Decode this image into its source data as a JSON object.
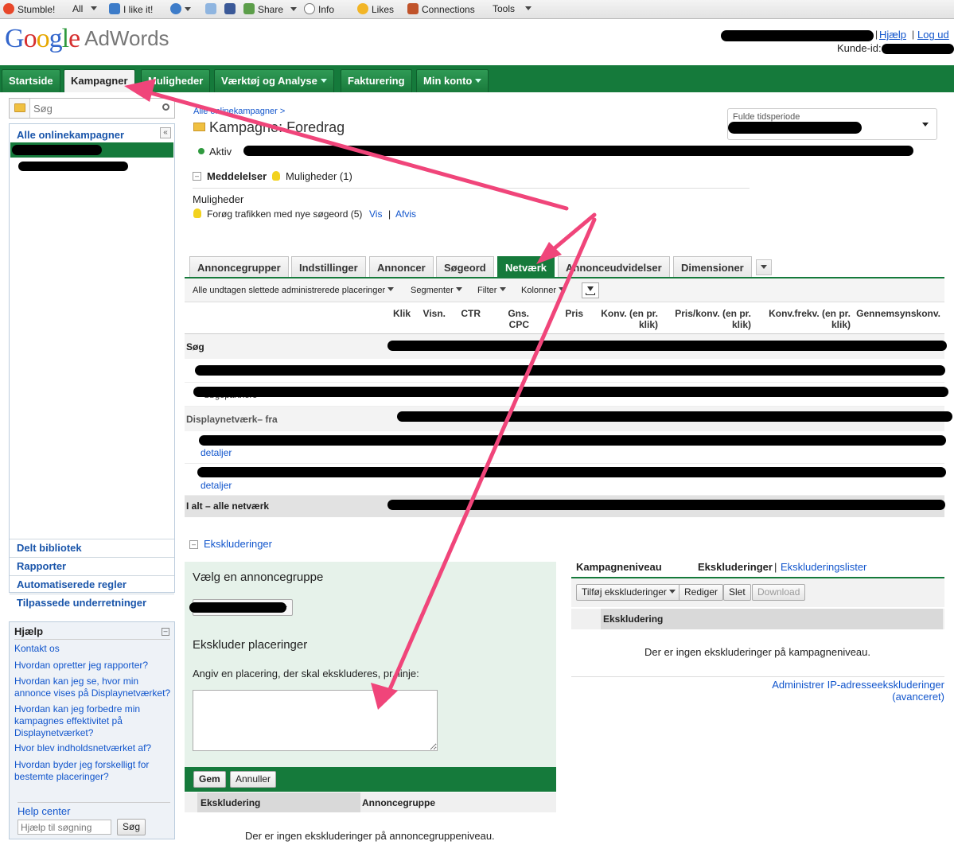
{
  "browser_toolbar": {
    "stumble": "Stumble!",
    "all": "All",
    "ilike": "I like it!",
    "share": "Share",
    "info": "Info",
    "likes": "Likes",
    "connections": "Connections",
    "tools": "Tools"
  },
  "header": {
    "logo_google": "Google",
    "logo_adwords": "AdWords",
    "help_link": "Hjælp",
    "logout_link": "Log ud",
    "customer_id_label": "Kunde-id:"
  },
  "main_nav": {
    "tabs": [
      {
        "label": "Startside"
      },
      {
        "label": "Kampagner"
      },
      {
        "label": "Muligheder"
      },
      {
        "label": "Værktøj og Analyse"
      },
      {
        "label": "Fakturering"
      },
      {
        "label": "Min konto"
      }
    ]
  },
  "sidebar": {
    "search_placeholder": "Søg",
    "all_campaigns": "Alle onlinekampagner",
    "links": [
      {
        "label": "Delt bibliotek"
      },
      {
        "label": "Rapporter"
      },
      {
        "label": "Automatiserede regler"
      },
      {
        "label": "Tilpassede underretninger"
      }
    ],
    "help": {
      "title": "Hjælp",
      "links": [
        {
          "label": "Kontakt os"
        },
        {
          "label": "Hvordan opretter jeg rapporter?"
        },
        {
          "label": "Hvordan kan jeg se, hvor min annonce vises på Displaynetværket?"
        },
        {
          "label": "Hvordan kan jeg forbedre min kampagnes effektivitet på Displaynetværket?"
        },
        {
          "label": "Hvor blev indholdsnetværket af?"
        },
        {
          "label": "Hvordan byder jeg forskelligt for bestemte placeringer?"
        }
      ],
      "help_center": "Help center",
      "search_placeholder": "Hjælp til søgning",
      "search_button": "Søg"
    }
  },
  "campaign": {
    "breadcrumb": "Alle onlinekampagner >",
    "title": "Kampagne: Foredrag",
    "status": "Aktiv",
    "date_range_label": "Fulde tidsperiode",
    "notices_label": "Meddelelser",
    "opportunities_label": "Muligheder (1)",
    "opportunities_heading": "Muligheder",
    "opportunity_text": "Forøg trafikken med nye søgeord (5)",
    "view_link": "Vis",
    "dismiss_link": "Afvis"
  },
  "content_tabs": {
    "tabs": [
      {
        "label": "Annoncegrupper"
      },
      {
        "label": "Indstillinger"
      },
      {
        "label": "Annoncer"
      },
      {
        "label": "Søgeord"
      },
      {
        "label": "Netværk"
      },
      {
        "label": "Annonceudvidelser"
      },
      {
        "label": "Dimensioner"
      }
    ]
  },
  "filter_bar": {
    "scope": "Alle undtagen slettede administrerede placeringer",
    "segment": "Segmenter",
    "filter": "Filter",
    "columns": "Kolonner"
  },
  "table": {
    "columns": [
      "Klik",
      "Visn.",
      "CTR",
      "Gns. CPC",
      "Pris",
      "Konv. (en pr. klik)",
      "Pris/konv. (en pr. klik)",
      "Konv.frekv. (en pr. klik)",
      "Gennemsynskonv."
    ],
    "rows": {
      "search": "Søg",
      "search_partners": "Søgepartnere",
      "display": "Displaynetværk– fra",
      "details": "detaljer",
      "total": "I alt – alle netværk"
    }
  },
  "exclusions": {
    "toggle_label": "Ekskluderinger",
    "choose_adgroup": "Vælg en annoncegruppe",
    "exclude_placements": "Ekskluder placeringer",
    "instruction": "Angiv en placering, der skal ekskluderes, pr. linje:",
    "save_button": "Gem",
    "cancel_button": "Annuller",
    "col_exclusion": "Ekskludering",
    "col_adgroup": "Annoncegruppe",
    "empty_adgroup": "Der er ingen ekskluderinger på annoncegruppeniveau.",
    "campaign_level": "Kampagneniveau",
    "exclusions_label": "Ekskluderinger",
    "exclusion_lists": "Ekskluderingslister",
    "add_button": "Tilføj ekskluderinger",
    "edit_button": "Rediger",
    "delete_button": "Slet",
    "download_button": "Download",
    "col_exclusion_right": "Ekskludering",
    "empty_campaign": "Der er ingen ekskluderinger på kampagneniveau.",
    "ip_link": "Administrer IP-adresseekskluderinger (avanceret)"
  },
  "colors": {
    "nav_green": "#157a3b",
    "link_blue": "#1155cc",
    "annotation_pink": "#f0457a"
  }
}
